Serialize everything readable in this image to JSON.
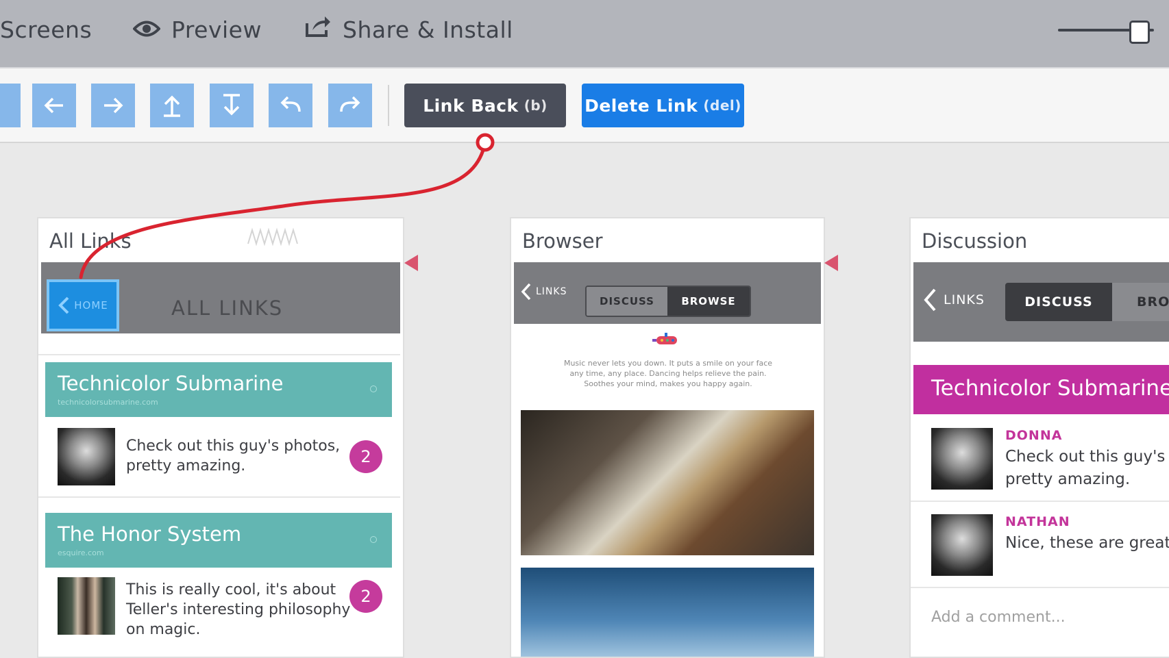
{
  "topbar": {
    "nav": [
      {
        "label": "Screens",
        "icon": ""
      },
      {
        "label": "Preview",
        "icon": "eye-icon"
      },
      {
        "label": "Share & Install",
        "icon": "share-icon"
      }
    ],
    "zoom_level": 0.85
  },
  "toolbar": {
    "arrow_buttons": [
      "arrow-left-icon",
      "arrow-right-icon",
      "arrow-up-icon",
      "arrow-down-icon",
      "undo-icon",
      "redo-icon"
    ],
    "link_back": {
      "label": "Link Back",
      "key": "(b)"
    },
    "delete_link": {
      "label": "Delete Link",
      "key": "(del)"
    }
  },
  "colors": {
    "accent": "#1a7de6",
    "link_wire": "#d92430",
    "teal": "#63b6b2",
    "magenta": "#c12f9f"
  },
  "panels": {
    "all_links": {
      "title": "All Links",
      "home_label": "HOME",
      "nav_title": "ALL LINKS",
      "items": [
        {
          "title": "Technicolor Submarine",
          "site": "technicolorsubmarine.com",
          "text_l1": "Check out this guy's photos,",
          "text_l2": "pretty amazing.",
          "text_l3": "",
          "count": "2"
        },
        {
          "title": "The Honor System",
          "site": "esquire.com",
          "text_l1": "This is really cool, it's about",
          "text_l2": "Teller's interesting philosophy",
          "text_l3": "on magic.",
          "count": "2"
        }
      ]
    },
    "browser": {
      "title": "Browser",
      "back_label": "LINKS",
      "tabs": [
        "DISCUSS",
        "BROWSE"
      ],
      "blurb_l1": "Music never lets you down. It puts a smile on your face",
      "blurb_l2": "any time, any place. Dancing helps relieve the pain.",
      "blurb_l3": "Soothes your mind, makes you happy again."
    },
    "discussion": {
      "title": "Discussion",
      "back_label": "LINKS",
      "tabs": [
        "DISCUSS",
        "BRO"
      ],
      "card_title": "Technicolor Submarine",
      "comments": [
        {
          "name": "DONNA",
          "l1": "Check out this guy's ph",
          "l2": "pretty amazing."
        },
        {
          "name": "NATHAN",
          "l1": "Nice, these are great.",
          "l2": ""
        }
      ],
      "add_comment": "Add a comment..."
    }
  }
}
